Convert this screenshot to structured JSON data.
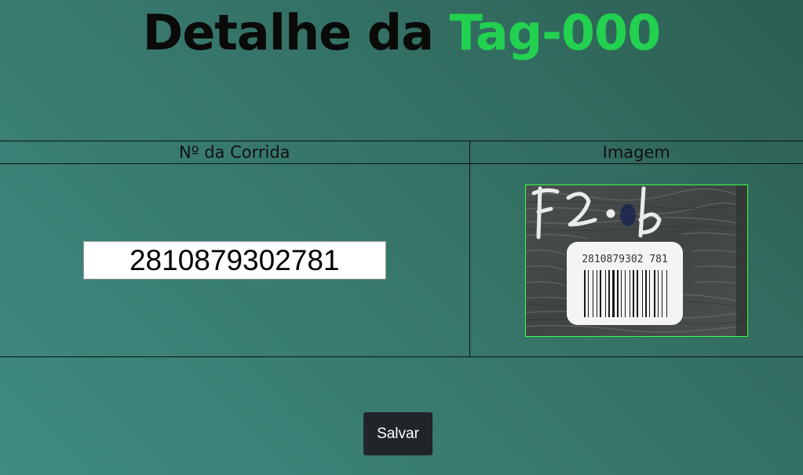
{
  "header": {
    "title_prefix": "Detalhe da",
    "title_tag": "Tag-000",
    "tag_color": "#22d14f"
  },
  "table": {
    "columns": [
      "Nº da Corrida",
      "Imagem"
    ],
    "run_number_value": "2810879302781"
  },
  "image": {
    "handwritten_text": "F2.6",
    "label_text": "2810879302  781"
  },
  "actions": {
    "save_label": "Salvar"
  },
  "colors": {
    "background": "#367468",
    "button": "#212529",
    "accent": "#22d14f"
  }
}
